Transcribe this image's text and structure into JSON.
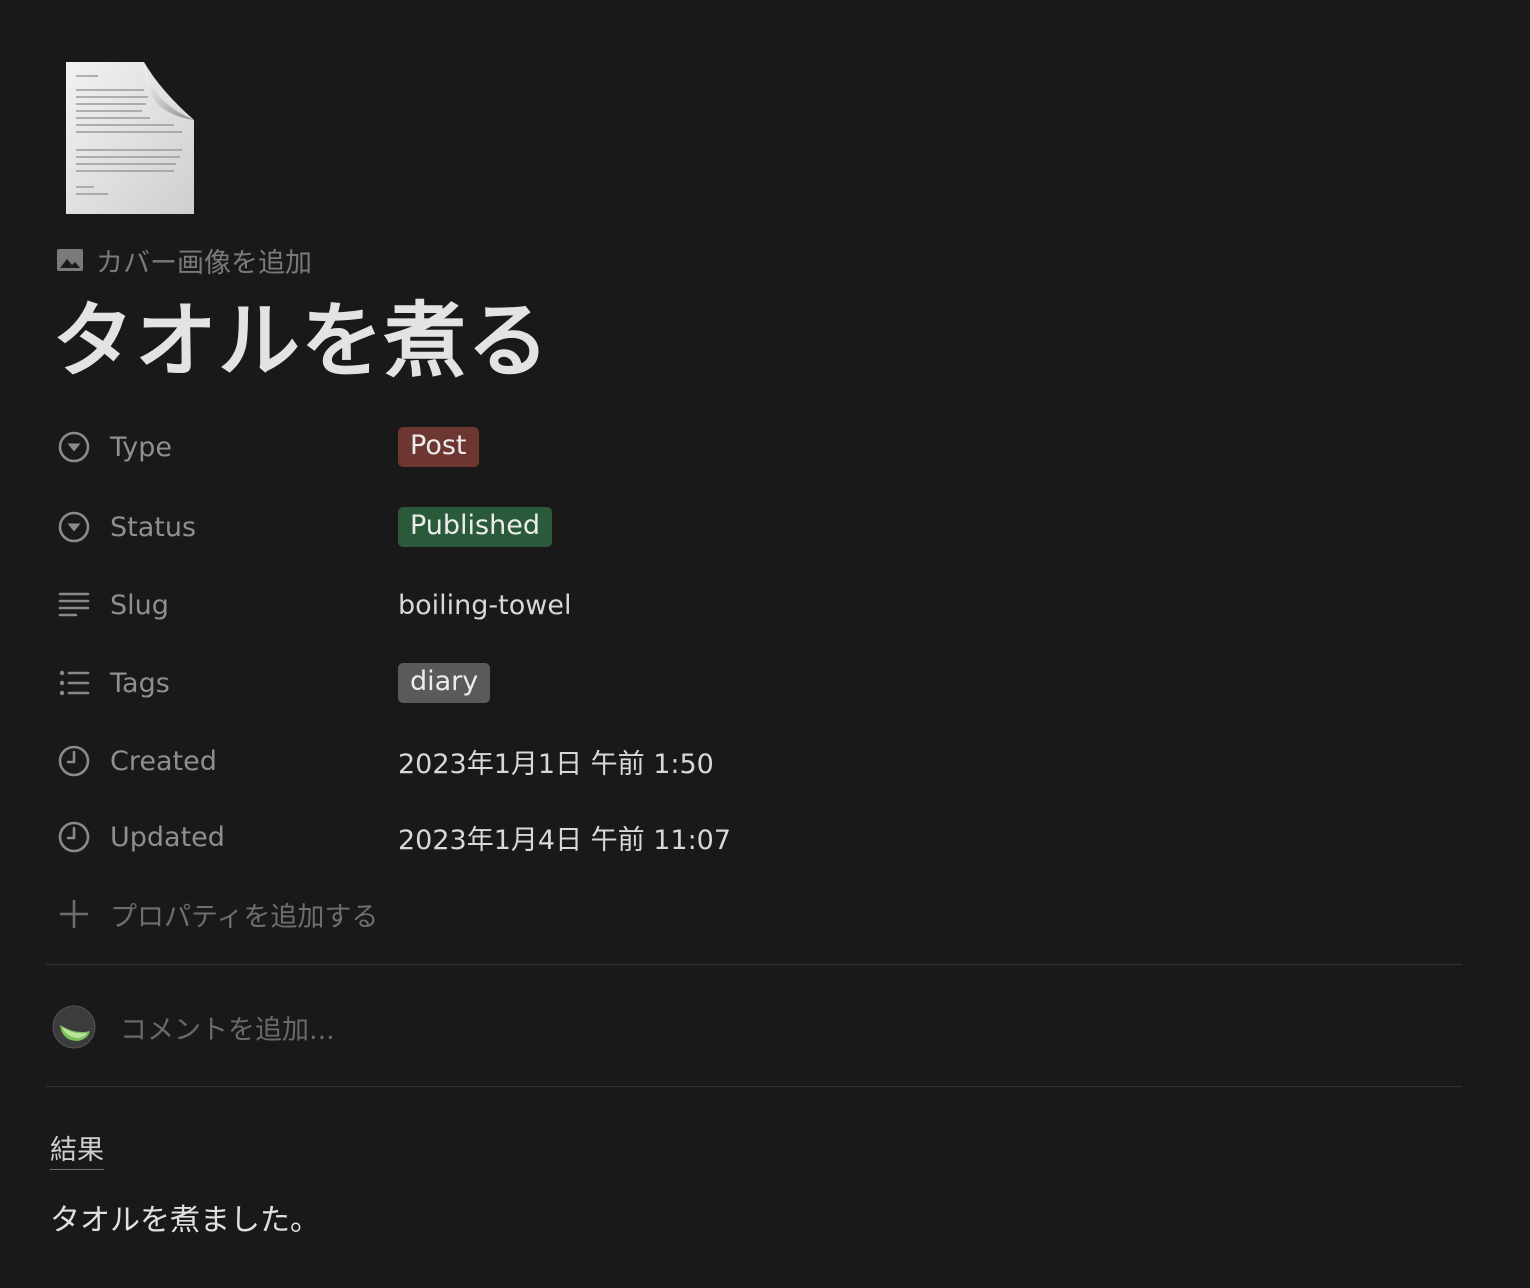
{
  "page": {
    "icon": "document-page-icon",
    "add_cover_label": "カバー画像を追加",
    "title": "タオルを煮る"
  },
  "properties": [
    {
      "name": "Type",
      "icon": "select-icon",
      "kind": "tag",
      "value": "Post",
      "tag_color": "#6e3630"
    },
    {
      "name": "Status",
      "icon": "select-icon",
      "kind": "tag",
      "value": "Published",
      "tag_color": "#2b5a3b"
    },
    {
      "name": "Slug",
      "icon": "text-icon",
      "kind": "text",
      "value": "boiling-towel"
    },
    {
      "name": "Tags",
      "icon": "list-icon",
      "kind": "tag",
      "value": "diary",
      "tag_color": "#5a5a5a"
    },
    {
      "name": "Created",
      "icon": "clock-icon",
      "kind": "text",
      "value": "2023年1月1日 午前 1:50"
    },
    {
      "name": "Updated",
      "icon": "clock-icon",
      "kind": "text",
      "value": "2023年1月4日 午前 11:07"
    }
  ],
  "add_property_label": "プロパティを追加する",
  "comment": {
    "placeholder": "コメントを追加..."
  },
  "content": {
    "heading": "結果",
    "paragraph": "タオルを煮ました。"
  },
  "colors": {
    "background": "#191919",
    "type_tag": "#6e3630",
    "status_tag": "#2b5a3b",
    "tags_tag": "#5a5a5a"
  }
}
